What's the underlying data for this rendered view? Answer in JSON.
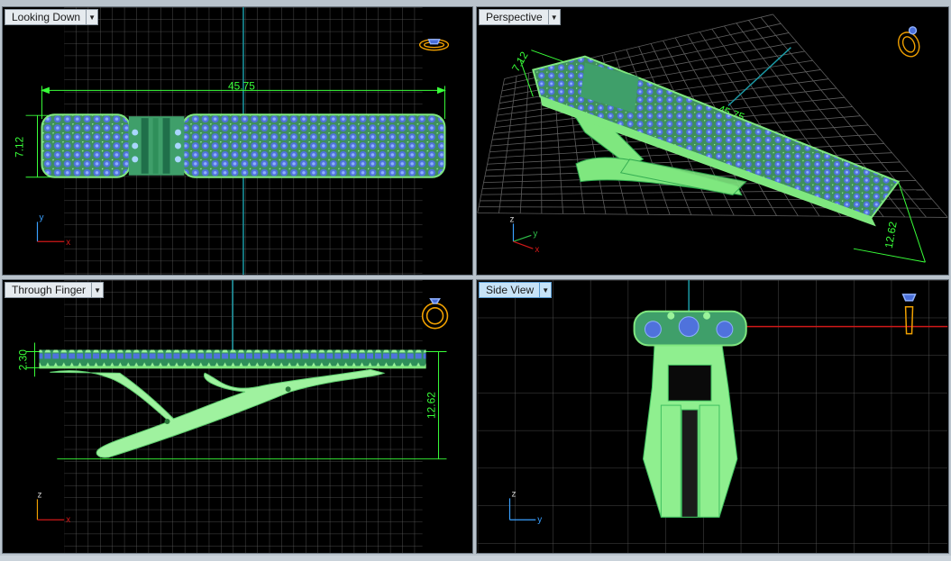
{
  "viewports": {
    "top": {
      "label": "Looking Down",
      "dim_length": "45.75",
      "dim_width": "7.12",
      "axis_v": "y",
      "axis_h": "x"
    },
    "perspective": {
      "label": "Perspective",
      "dim_length": "45.75",
      "dim_width": "7.12",
      "dim_height": "12.62",
      "axis_v": "z",
      "axis_h": "x",
      "axis_d": "y"
    },
    "front": {
      "label": "Through Finger",
      "dim_thickness": "2.30",
      "dim_height": "12.62",
      "axis_v": "z",
      "axis_h": "x"
    },
    "side": {
      "label": "Side View",
      "axis_v": "z",
      "axis_h": "y"
    }
  },
  "colors": {
    "grid": "#6a6a6a",
    "grid_major": "#9a9a9a",
    "metal": "#7fe77f",
    "metal_dark": "#2fa84f",
    "gem": "#4a6fd8",
    "dimension": "#39ff39",
    "axis_teal": "#1b9aa6",
    "axis_red": "#d01818",
    "icon": "#f0a000"
  },
  "icons": [
    "ring-top-icon",
    "ring-perspective-icon",
    "ring-front-icon",
    "ring-side-icon"
  ]
}
